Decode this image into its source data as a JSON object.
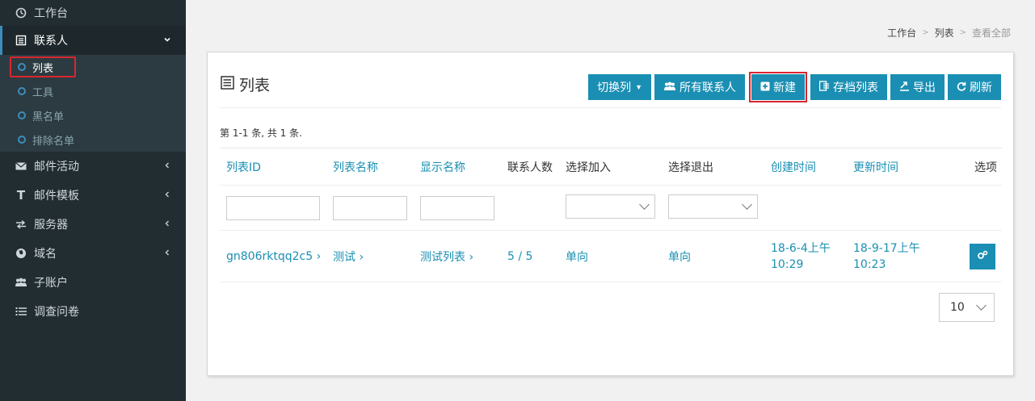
{
  "sidebar": {
    "items": [
      {
        "label": "工作台",
        "icon": "dashboard-icon"
      },
      {
        "label": "联系人",
        "icon": "list-icon"
      },
      {
        "label": "邮件活动",
        "icon": "envelope-icon"
      },
      {
        "label": "邮件模板",
        "icon": "text-icon"
      },
      {
        "label": "服务器",
        "icon": "exchange-icon"
      },
      {
        "label": "域名",
        "icon": "globe-icon"
      },
      {
        "label": "子账户",
        "icon": "users-icon"
      },
      {
        "label": "调查问卷",
        "icon": "list-ul-icon"
      }
    ],
    "contacts_sub": [
      {
        "label": "列表"
      },
      {
        "label": "工具"
      },
      {
        "label": "黑名单"
      },
      {
        "label": "排除名单"
      }
    ]
  },
  "breadcrumb": {
    "home": "工作台",
    "section": "列表",
    "current": "查看全部"
  },
  "card": {
    "title": "列表",
    "toolbar": {
      "toggle_cols": "切换列",
      "all_contacts": "所有联系人",
      "new": "新建",
      "archived": "存档列表",
      "export": "导出",
      "refresh": "刷新"
    },
    "count_text": "第 1-1 条, 共 1 条."
  },
  "table": {
    "headers": [
      "列表ID",
      "列表名称",
      "显示名称",
      "联系人数",
      "选择加入",
      "选择退出",
      "创建时间",
      "更新时间",
      "选项"
    ],
    "rows": [
      {
        "id": "gn806rktqq2c5 ›",
        "name": "测试 ›",
        "display_name": "测试列表 ›",
        "contacts": "5 / 5",
        "opt_in": "单向",
        "opt_out": "单向",
        "created_1": "18-6-4上午",
        "created_2": "10:29",
        "updated_1": "18-9-17上午",
        "updated_2": "10:23"
      }
    ]
  },
  "pagination": {
    "page_size": "10"
  },
  "colors": {
    "sidebar_bg": "#222d32",
    "accent": "#1a8fb3",
    "highlight": "#d9262f"
  }
}
